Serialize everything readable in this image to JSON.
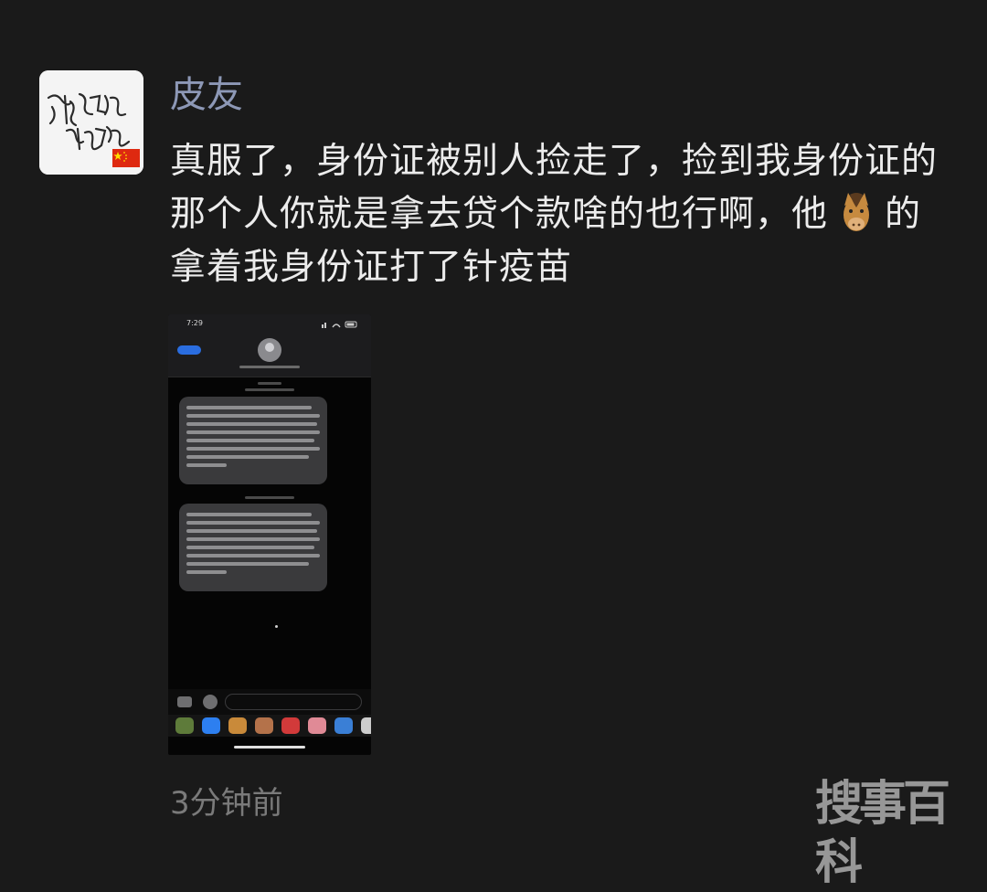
{
  "post": {
    "nickname": "皮友",
    "text_before_emoji": "真服了，身份证被别人捡走了，捡到我身份证的那个人你就是拿去贷个款啥的也行啊，他",
    "emoji": "horse-face-emoji",
    "text_after_emoji": "的拿着我身份证打了针疫苗",
    "time": "3分钟前"
  },
  "avatar": {
    "icon": "handwritten-calligraphy-avatar",
    "flag": "china-flag-icon"
  },
  "attachment": {
    "type": "phone-screenshot",
    "app": "messages",
    "status_time": "7:29",
    "message_count": 2
  },
  "watermark": {
    "text": "搜事百科"
  },
  "colors": {
    "background": "#1a1a1a",
    "nickname": "#8d98b6",
    "text": "#ececec",
    "timestamp": "#7a7a7a"
  }
}
